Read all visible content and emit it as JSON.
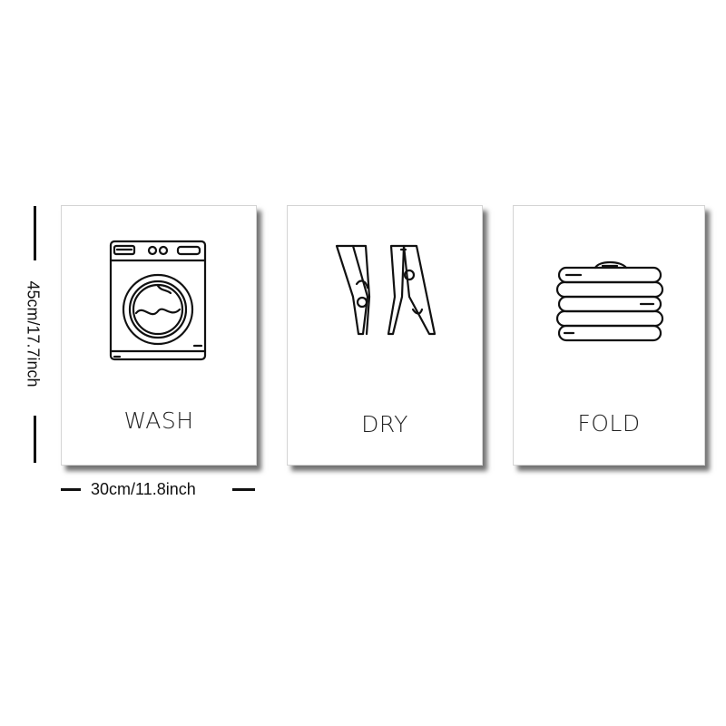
{
  "posters": [
    {
      "label": "WASH",
      "icon": "washing-machine-icon"
    },
    {
      "label": "DRY",
      "icon": "clothespin-icon"
    },
    {
      "label": "FOLD",
      "icon": "folded-towels-icon"
    }
  ],
  "dimensions": {
    "height": "45cm/17.7inch",
    "width": "30cm/11.8inch"
  },
  "colors": {
    "background": "#ffffff",
    "ink": "#111111",
    "shadow": "#555555"
  }
}
